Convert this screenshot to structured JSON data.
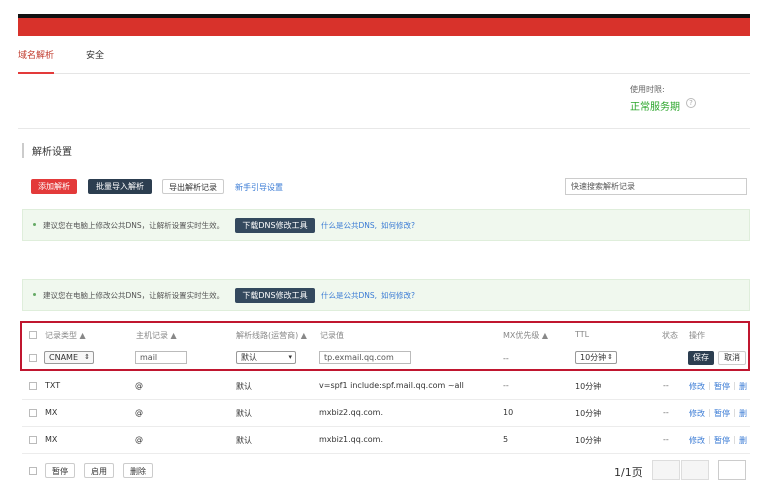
{
  "tabs": [
    "域名解析",
    "安全"
  ],
  "usage": {
    "label": "使用时限:",
    "status": "正常服务期"
  },
  "section_title": "解析设置",
  "toolbar": {
    "add": "添加解析",
    "batch_import": "批量导入解析",
    "export": "导出解析记录",
    "guide": "新手引导设置",
    "search_placeholder": "快速搜索解析记录"
  },
  "notice": {
    "text": "建议您在电脑上修改公共DNS，让解析设置实时生效。",
    "tool_button": "下载DNS修改工具",
    "link1": "什么是公共DNS,",
    "link2": "如何修改?"
  },
  "table": {
    "headers": {
      "type": "记录类型 ▲",
      "host": "主机记录 ▲",
      "line": "解析线路(运营商) ▲",
      "value": "记录值",
      "mx": "MX优先级 ▲",
      "ttl": "TTL",
      "status": "状态",
      "actions": "操作"
    },
    "edit_row": {
      "type": "CNAME",
      "host": "mail",
      "line": "默认",
      "value": "tp.exmail.qq.com",
      "mx": "--",
      "ttl": "10分钟",
      "save": "保存",
      "cancel": "取消"
    },
    "rows": [
      {
        "type": "TXT",
        "host": "@",
        "line": "默认",
        "value": "v=spf1 include:spf.mail.qq.com ~all",
        "mx": "--",
        "ttl": "10分钟",
        "status": "--"
      },
      {
        "type": "MX",
        "host": "@",
        "line": "默认",
        "value": "mxbiz2.qq.com.",
        "mx": "10",
        "ttl": "10分钟",
        "status": "--"
      },
      {
        "type": "MX",
        "host": "@",
        "line": "默认",
        "value": "mxbiz1.qq.com.",
        "mx": "5",
        "ttl": "10分钟",
        "status": "--"
      }
    ],
    "row_actions": {
      "edit": "修改",
      "pause": "暂停",
      "delete": "删"
    }
  },
  "bulk": {
    "pause": "暂停",
    "enable": "启用",
    "delete": "删除"
  },
  "pager": {
    "text": "1/1页"
  }
}
